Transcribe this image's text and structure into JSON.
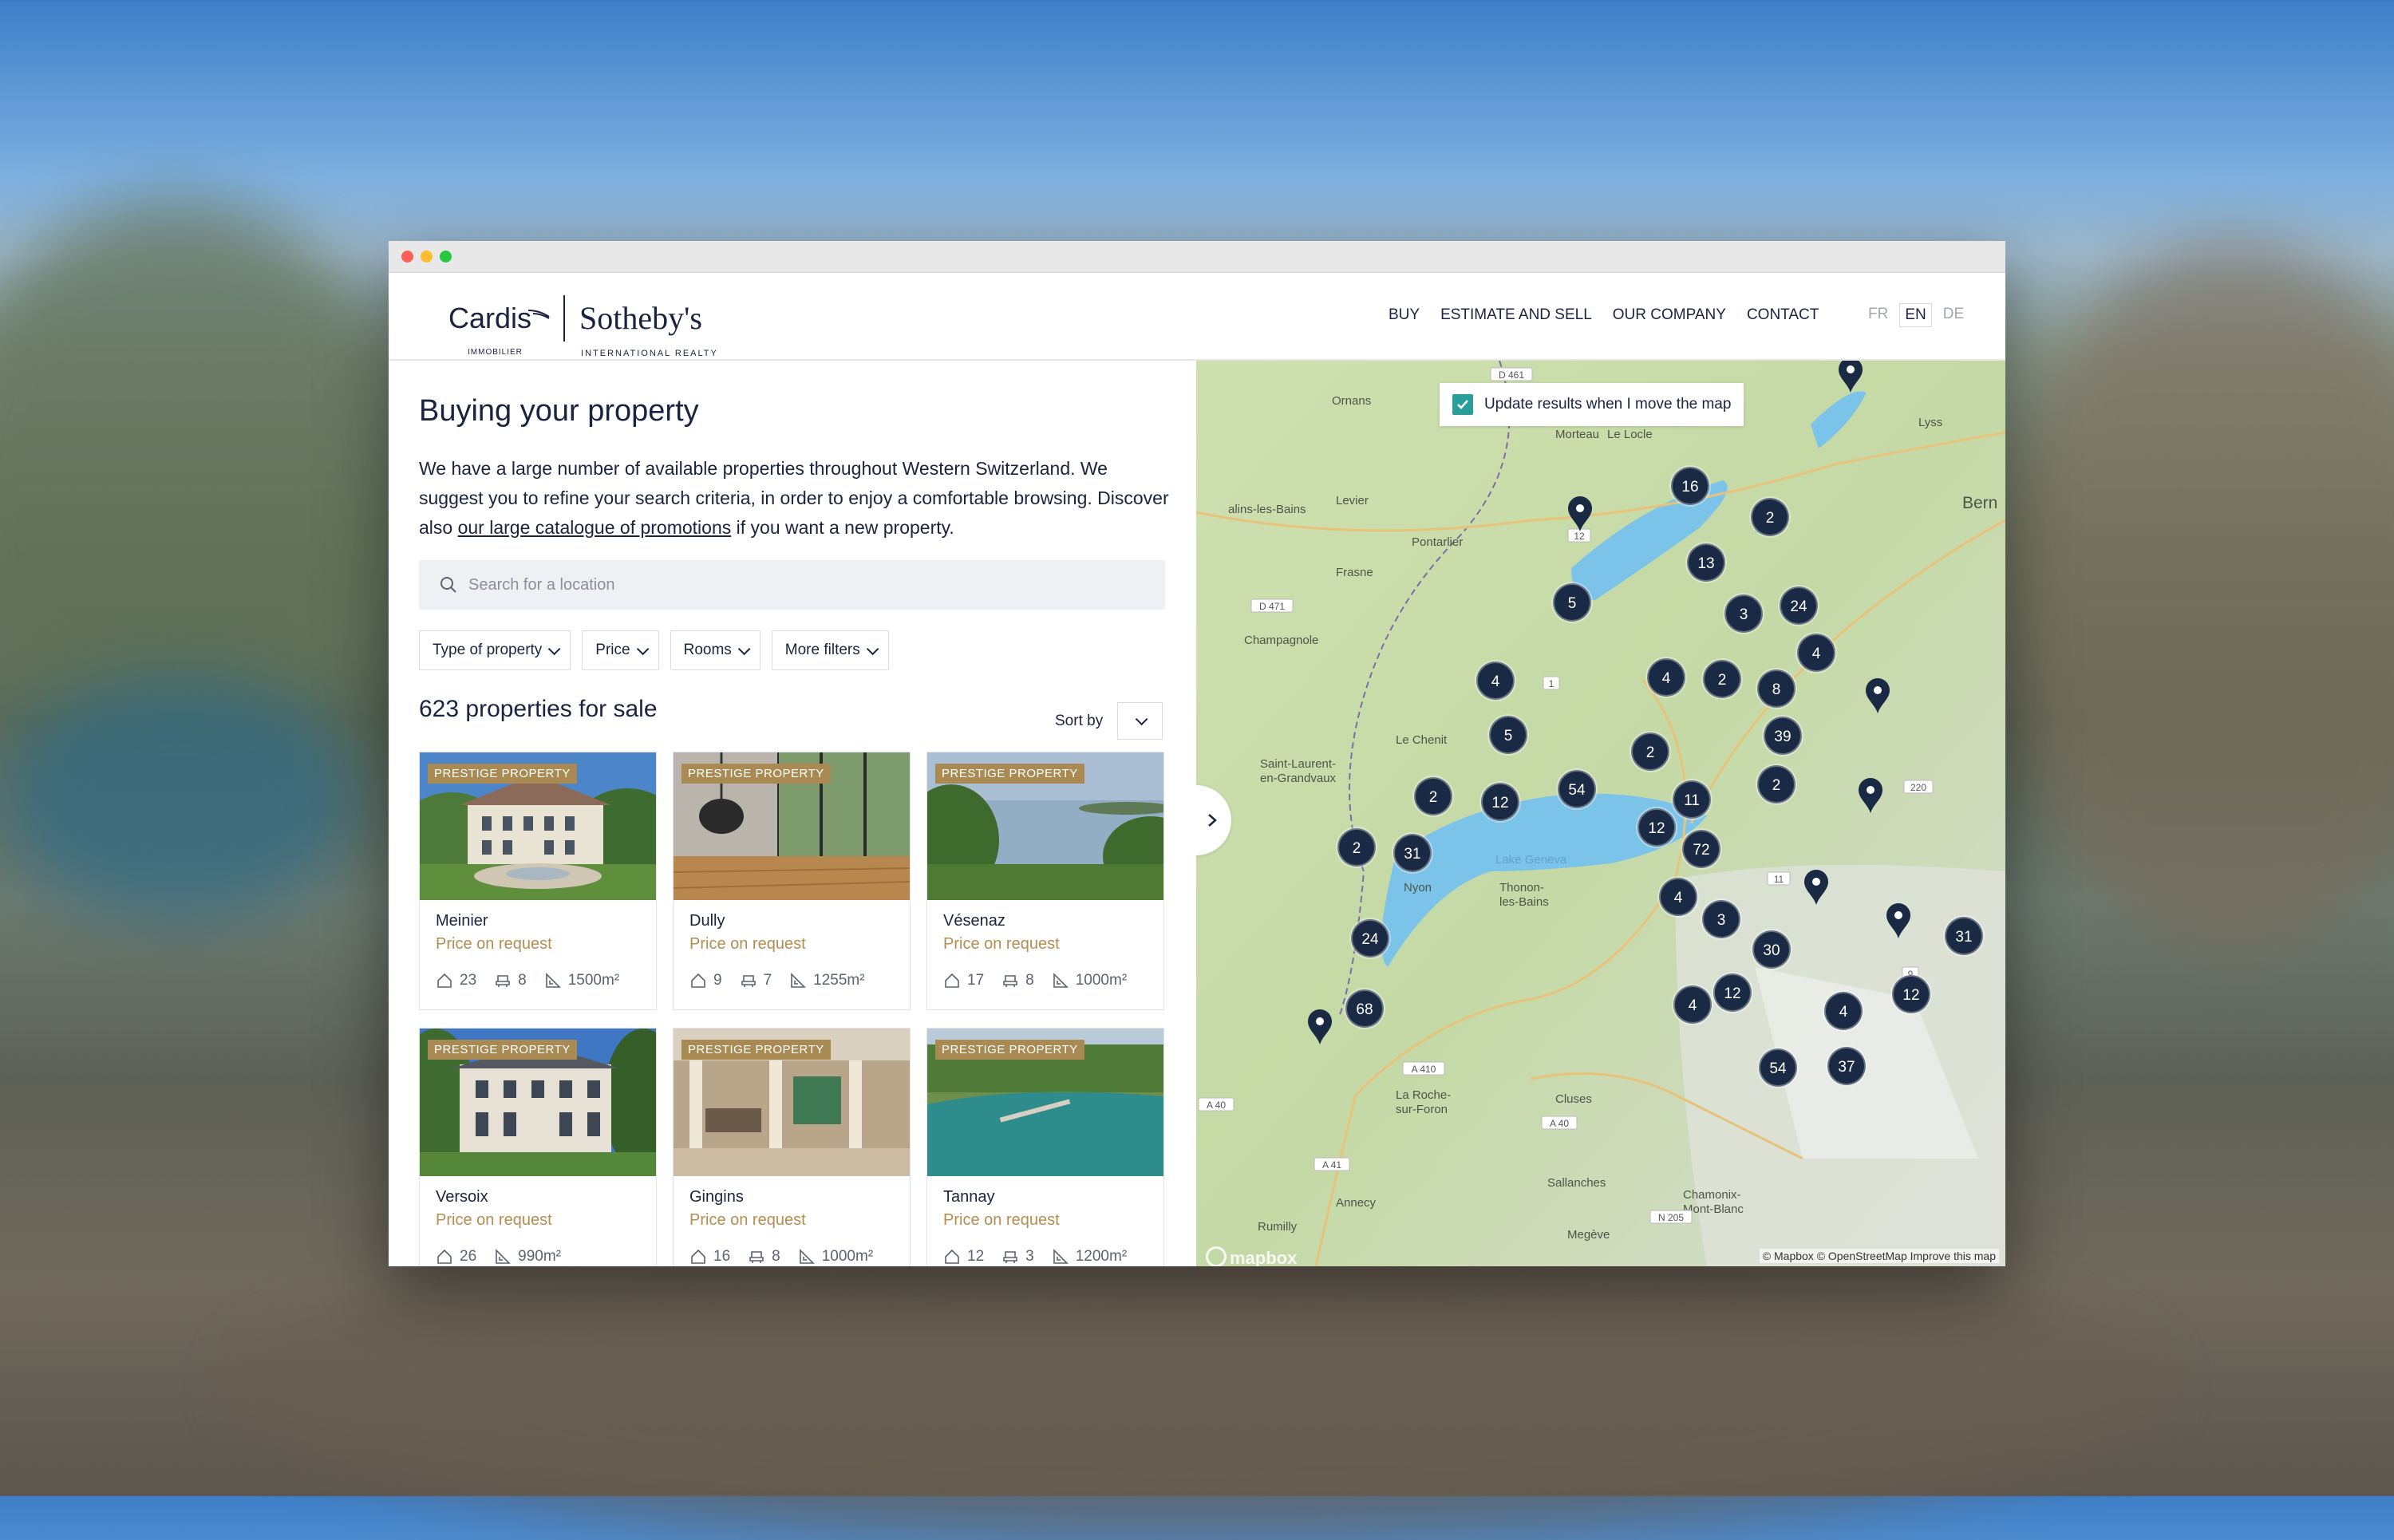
{
  "window": {
    "title": ""
  },
  "brand": {
    "cardis": "Cardis",
    "cardis_sub": "IMMOBILIER",
    "sothebys": "Sotheby's",
    "sothebys_sub": "INTERNATIONAL REALTY"
  },
  "nav": {
    "buy": "BUY",
    "estimate": "ESTIMATE AND SELL",
    "company": "OUR COMPANY",
    "contact": "CONTACT"
  },
  "lang": {
    "fr": "FR",
    "en": "EN",
    "de": "DE"
  },
  "page": {
    "title": "Buying your property",
    "intro_before": "We have a large number of available properties throughout Western Switzerland. We suggest you to refine your search criteria, in order to enjoy a comfortable browsing. Discover also ",
    "intro_link": "our large catalogue of promotions",
    "intro_after": " if you want a new property."
  },
  "search": {
    "placeholder": "Search for a location"
  },
  "filters": {
    "type": "Type of property",
    "price": "Price",
    "rooms": "Rooms",
    "more": "More filters"
  },
  "results": {
    "count": "623 properties for sale",
    "sort_label": "Sort by"
  },
  "cards": [
    {
      "badge": "PRESTIGE PROPERTY",
      "name": "Meinier",
      "price": "Price on request",
      "rooms": "23",
      "baths": "8",
      "area": "1500m²"
    },
    {
      "badge": "PRESTIGE PROPERTY",
      "name": "Dully",
      "price": "Price on request",
      "rooms": "9",
      "baths": "7",
      "area": "1255m²"
    },
    {
      "badge": "PRESTIGE PROPERTY",
      "name": "Vésenaz",
      "price": "Price on request",
      "rooms": "17",
      "baths": "8",
      "area": "1000m²"
    },
    {
      "badge": "PRESTIGE PROPERTY",
      "name": "Versoix",
      "price": "Price on request",
      "rooms": "26",
      "area": "990m²"
    },
    {
      "badge": "PRESTIGE PROPERTY",
      "name": "Gingins",
      "price": "Price on request",
      "rooms": "16",
      "baths": "8",
      "area": "1000m²"
    },
    {
      "badge": "PRESTIGE PROPERTY",
      "name": "Tannay",
      "price": "Price on request",
      "rooms": "12",
      "baths": "3",
      "area": "1200m²"
    }
  ],
  "map": {
    "update_label": "Update results when I move the map",
    "attribution": "© Mapbox © OpenStreetMap Improve this map",
    "mapbox_logo": "mapbox",
    "places": [
      "Ornans",
      "Morteau",
      "Le Locle",
      "Levier",
      "Pontarlier",
      "Frasne",
      "Champagnole",
      "Le Chenit",
      "Saint-Laurent-en-Grandvaux",
      "Nyon",
      "Thonon-les-Bains",
      "Lake Geneva",
      "La Roche-sur-Foron",
      "Cluses",
      "Sallanches",
      "Chamonix-Mont-Blanc",
      "Annecy",
      "Rumilly",
      "Megève",
      "Bern",
      "Lyss",
      "alins-les-Bains"
    ],
    "roads": [
      "D 461",
      "D 471",
      "A 40",
      "A 41",
      "A 410",
      "N 205",
      "A 40",
      "220",
      "11",
      "1",
      "12",
      "9"
    ],
    "clusters": [
      "16",
      "2",
      "13",
      "5",
      "3",
      "24",
      "4",
      "4",
      "2",
      "8",
      "4",
      "5",
      "39",
      "2",
      "2",
      "54",
      "11",
      "2",
      "12",
      "12",
      "72",
      "2",
      "31",
      "4",
      "3",
      "24",
      "30",
      "68",
      "12",
      "4",
      "4",
      "54",
      "37",
      "31",
      "12"
    ]
  },
  "colors": {
    "navy": "#1a2340",
    "gold": "#a88a52",
    "price": "#b48d4f",
    "lake": "#7cc3ea",
    "cluster": "#1a2a44"
  }
}
